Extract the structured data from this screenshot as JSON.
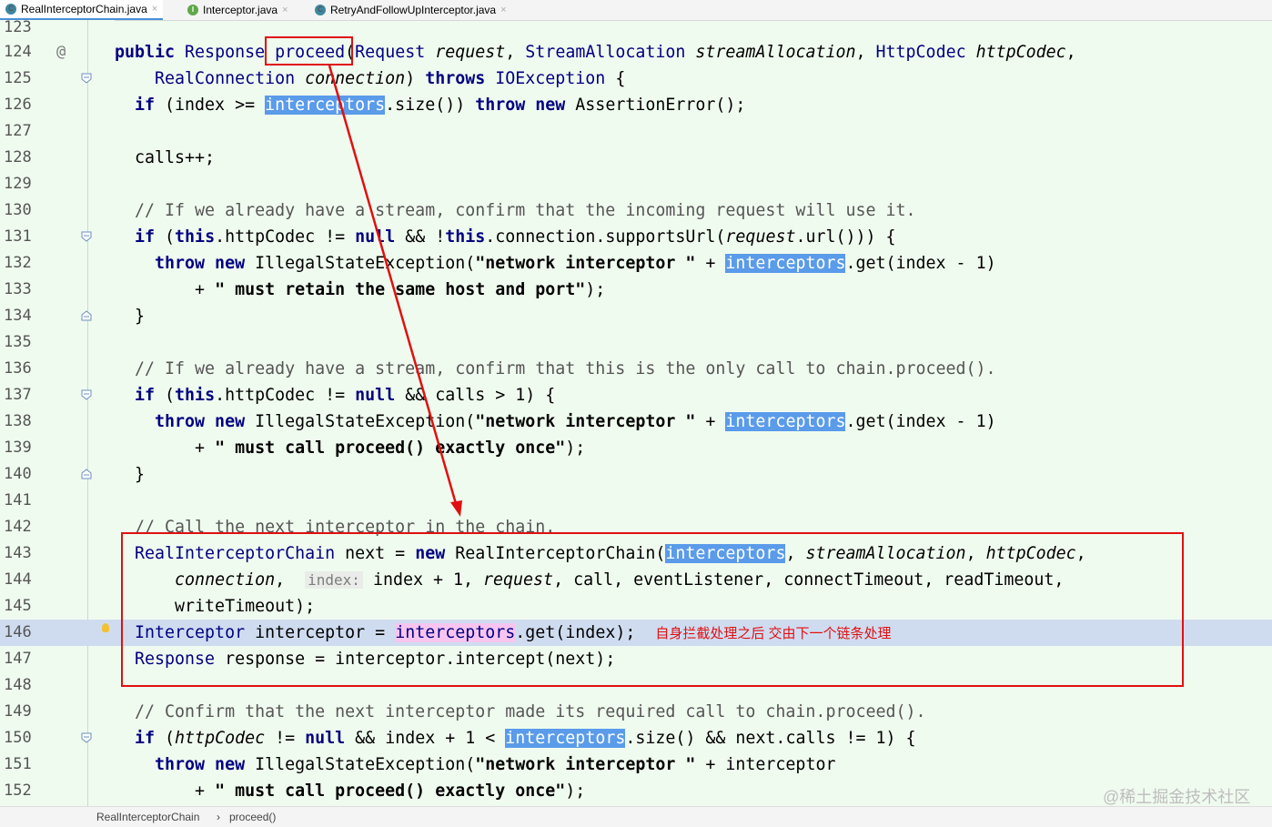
{
  "tabs": [
    {
      "label": "RealInterceptorChain.java",
      "icon": "class-icon",
      "active": true
    },
    {
      "label": "Interceptor.java",
      "icon": "interface-icon",
      "active": false
    },
    {
      "label": "RetryAndFollowUpInterceptor.java",
      "icon": "class-icon",
      "active": false
    }
  ],
  "line_numbers": [
    "123",
    "124",
    "125",
    "126",
    "127",
    "128",
    "129",
    "130",
    "131",
    "132",
    "133",
    "134",
    "135",
    "136",
    "137",
    "138",
    "139",
    "140",
    "141",
    "142",
    "143",
    "144",
    "145",
    "146",
    "147",
    "148",
    "149",
    "150",
    "151",
    "152"
  ],
  "code": {
    "l124": {
      "a": "public ",
      "b": "Response ",
      "c": "proceed",
      "d": "(",
      "e": "Request ",
      "f": "request",
      "g": ", ",
      "h": "StreamAllocation ",
      "i": "streamAllocation",
      "j": ", ",
      "k": "HttpCodec ",
      "l": "httpCodec",
      "m": ","
    },
    "l125": {
      "a": "    ",
      "b": "RealConnection ",
      "c": "connection",
      "d": ") ",
      "e": "throws ",
      "f": "IOException ",
      "g": "{"
    },
    "l126": {
      "a": "  if ",
      "b": "(index >= ",
      "c": "interceptors",
      "d": ".size()) ",
      "e": "throw new ",
      "f": "AssertionError();"
    },
    "l128": "  calls++;",
    "l130": "  // If we already have a stream, confirm that the incoming request will use it.",
    "l131": {
      "a": "  if ",
      "b": "(",
      "c": "this",
      "d": ".httpCodec != ",
      "e": "null ",
      "f": "&& !",
      "g": "this",
      "h": ".connection.supportsUrl(",
      "i": "request",
      "j": ".url())) {"
    },
    "l132": {
      "a": "    throw new ",
      "b": "IllegalStateException(",
      "c": "\"network interceptor \"",
      "d": " + ",
      "e": "interceptors",
      "f": ".get(index - 1)"
    },
    "l133": {
      "a": "        + ",
      "b": "\" must retain the same host and port\"",
      "c": ");"
    },
    "l134": "  }",
    "l136": "  // If we already have a stream, confirm that this is the only call to chain.proceed().",
    "l137": {
      "a": "  if ",
      "b": "(",
      "c": "this",
      "d": ".httpCodec != ",
      "e": "null ",
      "f": "&& calls > 1) {"
    },
    "l138": {
      "a": "    throw new ",
      "b": "IllegalStateException(",
      "c": "\"network interceptor \"",
      "d": " + ",
      "e": "interceptors",
      "f": ".get(index - 1)"
    },
    "l139": {
      "a": "        + ",
      "b": "\" must call proceed() exactly once\"",
      "c": ");"
    },
    "l140": "  }",
    "l142": "  // Call the next interceptor in the chain.",
    "l143": {
      "a": "  RealInterceptorChain ",
      "b": "next = ",
      "c": "new ",
      "d": "RealInterceptorChain(",
      "e": "interceptors",
      "f": ", ",
      "g": "streamAllocation",
      "h": ", ",
      "i": "httpCodec",
      "j": ","
    },
    "l144": {
      "a": "      ",
      "b": "connection",
      "c": ",  ",
      "d": "index:",
      "e": " index + 1, ",
      "f": "request",
      "g": ", call, eventListener, connectTimeout, readTimeout,"
    },
    "l145": {
      "a": "      writeTimeout);"
    },
    "l146": {
      "a": "  Interceptor ",
      "b": "interceptor = ",
      "c": "interceptors",
      "d": ".get(index);",
      "e": "自身拦截处理之后 交由下一个链条处理"
    },
    "l147": {
      "a": "  Response ",
      "b": "response = interceptor.intercept(next);"
    },
    "l149": "  // Confirm that the next interceptor made its required call to chain.proceed().",
    "l150": {
      "a": "  if ",
      "b": "(",
      "c": "httpCodec",
      "d": " != ",
      "e": "null ",
      "f": "&& index + 1 < ",
      "g": "interceptors",
      "h": ".size() && next.calls != 1) {"
    },
    "l151": {
      "a": "    throw new ",
      "b": "IllegalStateException(",
      "c": "\"network interceptor \"",
      "d": " + interceptor"
    },
    "l152": {
      "a": "        + ",
      "b": "\" must call proceed() exactly once\"",
      "c": ");"
    }
  },
  "breadcrumb": {
    "class": "RealInterceptorChain",
    "sep": "›",
    "method": "proceed()"
  },
  "watermark": "@稀土掘金技术社区",
  "colors": {
    "keyword": "#000080",
    "selection": "#5a9bea",
    "annotation": "#e01010",
    "current_line": "#cfdcf0",
    "background": "#f0fbef"
  }
}
